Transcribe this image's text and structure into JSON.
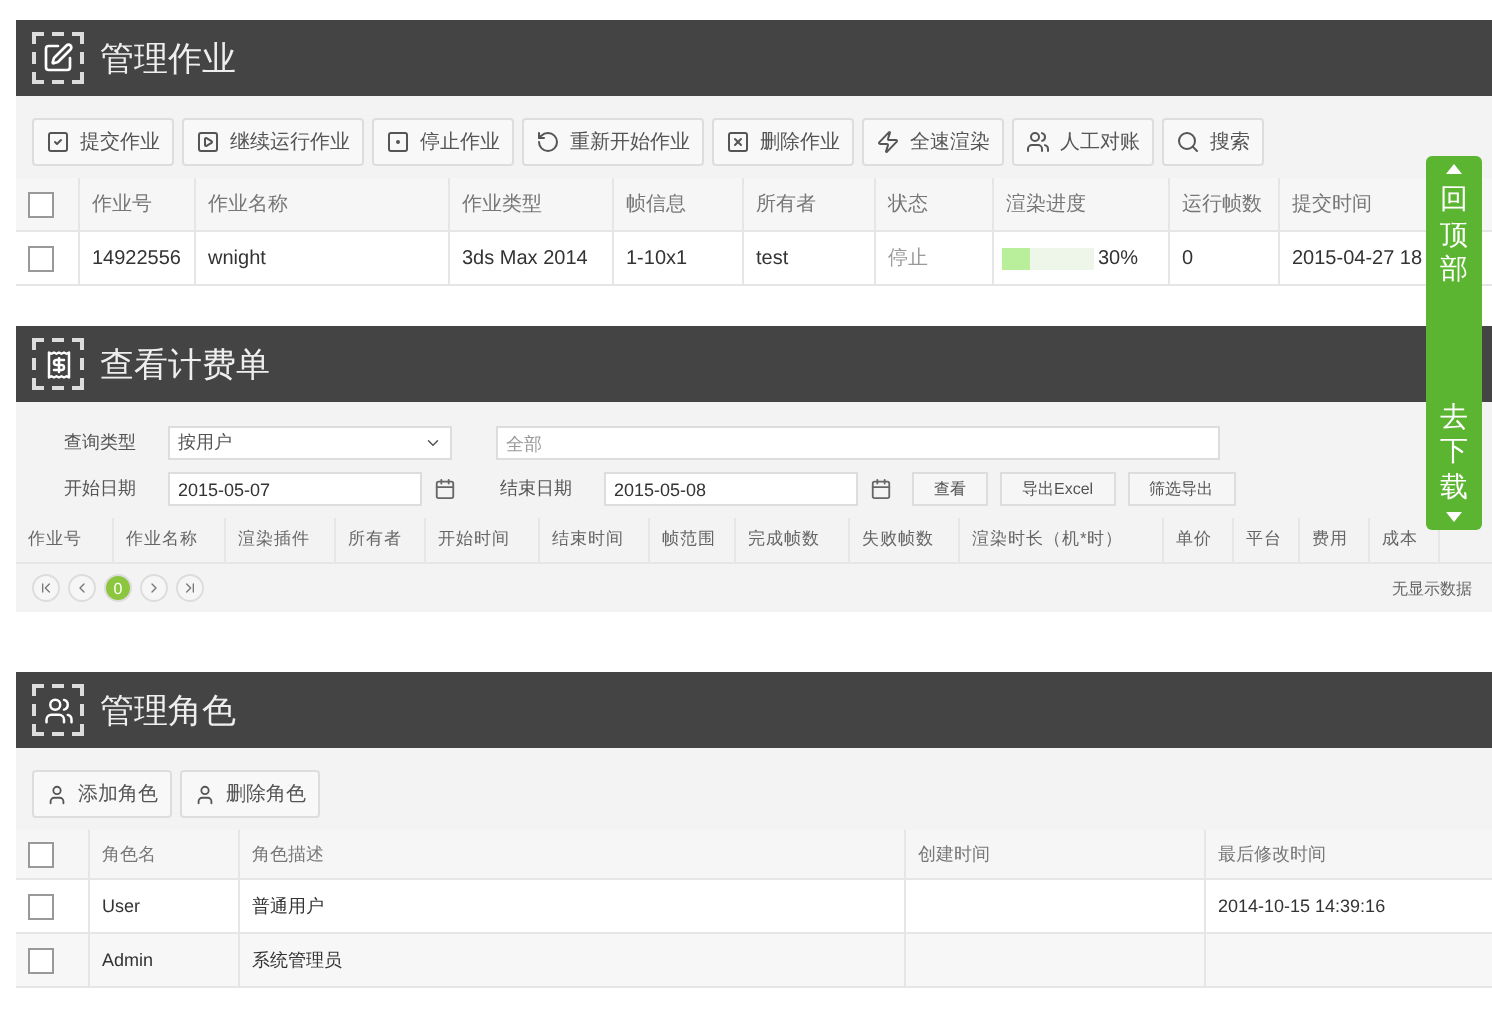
{
  "jobs_panel": {
    "title": "管理作业",
    "select_all_checked": false,
    "toolbar": [
      {
        "label": "提交作业",
        "kind": "submit"
      },
      {
        "label": "继续运行作业",
        "kind": "resume"
      },
      {
        "label": "停止作业",
        "kind": "stop"
      },
      {
        "label": "重新开始作业",
        "kind": "restart"
      },
      {
        "label": "删除作业",
        "kind": "delete"
      },
      {
        "label": "全速渲染",
        "kind": "fast"
      },
      {
        "label": "人工对账",
        "kind": "people"
      },
      {
        "label": "搜索",
        "kind": "search"
      }
    ],
    "columns": [
      "作业号",
      "作业名称",
      "作业类型",
      "帧信息",
      "所有者",
      "状态",
      "渲染进度",
      "运行帧数",
      "提交时间"
    ],
    "rows": [
      {
        "checked": false,
        "job_id": "14922556",
        "name": "wnight",
        "type": "3ds Max 2014",
        "frames": "1-10x1",
        "owner": "test",
        "status": "停止",
        "level": 0.3,
        "progress": "30%",
        "run_frames": "0",
        "submitted": "2015-04-27 18"
      }
    ]
  },
  "billing_panel": {
    "title": "查看计费单",
    "query_type_label": "查询类型",
    "query_type": "按用户",
    "scope": {
      "placeholder": "全部"
    },
    "start_label": "开始日期",
    "start_date": "2015-05-07",
    "end_label": "结束日期",
    "end_date": "2015-05-08",
    "buttons": [
      "查看",
      "导出Excel",
      "筛选导出"
    ],
    "columns": [
      "作业号",
      "作业名称",
      "渲染插件",
      "所有者",
      "开始时间",
      "结束时间",
      "帧范围",
      "完成帧数",
      "失败帧数",
      "渲染时长（机*时）",
      "单价",
      "平台",
      "费用",
      "成本"
    ],
    "pager": [
      {
        "kind": "first"
      },
      {
        "kind": "prev"
      },
      {
        "kind": "page",
        "label": "0",
        "selected": true
      },
      {
        "kind": "next"
      },
      {
        "kind": "last"
      }
    ],
    "empty_note": "无显示数据"
  },
  "roles_panel": {
    "title": "管理角色",
    "select_all_checked": false,
    "toolbar": [
      "添加角色",
      "删除角色"
    ],
    "columns": [
      "角色名",
      "角色描述",
      "创建时间",
      "最后修改时间"
    ],
    "rows": [
      {
        "checked": false,
        "name": "User",
        "description": "普通用户",
        "modified": "2014-10-15 14:39:16"
      },
      {
        "checked": false,
        "name": "Admin",
        "description": "系统管理员"
      }
    ]
  },
  "float_nav": {
    "top": "回顶部",
    "download": "去下载"
  }
}
